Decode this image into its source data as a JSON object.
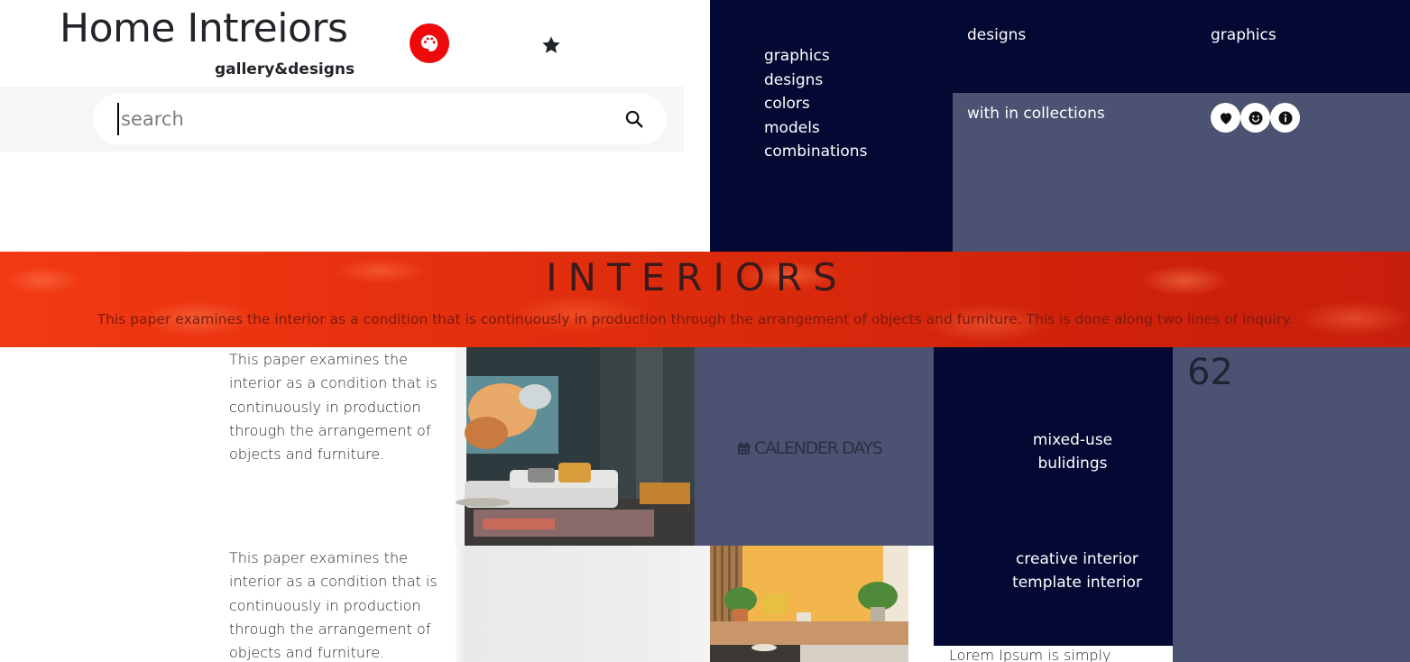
{
  "header": {
    "title": "Home Intreiors",
    "subtitle": "gallery&designs",
    "palette_icon": "palette-icon",
    "star_icon": "star-icon"
  },
  "search": {
    "placeholder": "search",
    "value": "",
    "icon": "search-icon"
  },
  "menu": {
    "items": [
      "graphics",
      "designs",
      "colors",
      "models",
      "combinations"
    ],
    "top_links": [
      "designs",
      "graphics"
    ]
  },
  "collections": {
    "label": "with in collections",
    "icons": [
      "heart-icon",
      "smile-icon",
      "info-icon"
    ]
  },
  "banner": {
    "title": "INTERIORS",
    "text": "This paper examines the interior as a condition that is continuously in production through the arrangement of objects and furniture. This is done along two lines of inquiry."
  },
  "content": {
    "paragraph_1": "This paper examines the interior as a condition that is continuously in production through the arrangement of objects and furniture.",
    "paragraph_2": "This paper examines the interior as a condition that is continuously in production through the arrangement of objects and furniture.",
    "calendar_label": "CALENDER DAYS",
    "calendar_icon": "calendar-icon",
    "mixed_use": [
      "mixed-use",
      "bulidings"
    ],
    "creative": [
      "creative interior",
      "template interior"
    ],
    "counter": "62",
    "lorem": "Lorem Ipsum is simply"
  },
  "colors": {
    "navy": "#030933",
    "slate": "#4c5272",
    "accent_red": "#ee0a0a",
    "banner_red": "#e0300f"
  }
}
